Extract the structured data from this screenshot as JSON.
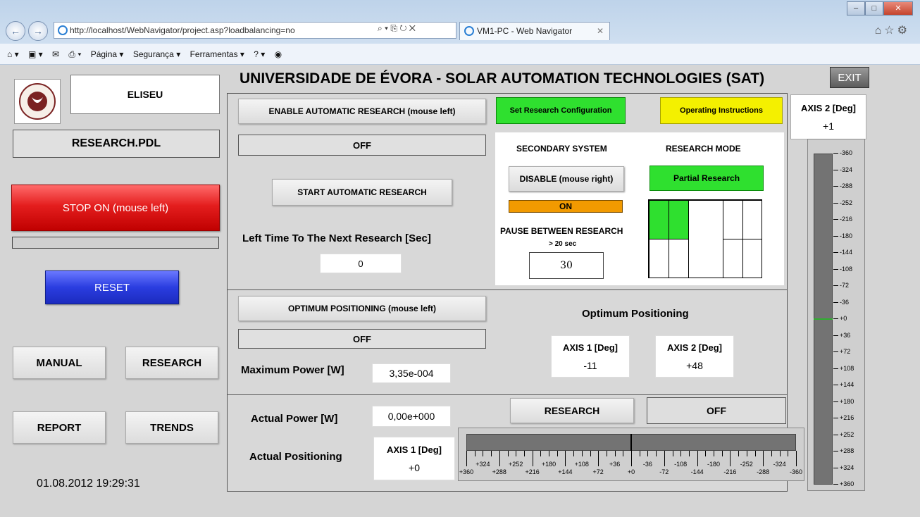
{
  "browser": {
    "url": "http://localhost/WebNavigator/project.asp?loadbalancing=no",
    "url_host": "localhost",
    "addr_tools": "⌕ ▾ ⎘ ↻ ✕",
    "tab_title": "VM1-PC - Web Navigator",
    "tab_close": "✕",
    "window_buttons": {
      "minimize": "–",
      "maximize": "□",
      "close": "✕"
    },
    "right_icons": "⌂☆⚙",
    "back": "←",
    "forward": "→",
    "menu": {
      "home": "⌂ ▾",
      "feeds": "▣ ▾",
      "mail": "✉",
      "print": "⎙ ▾",
      "pagina": "Página ▾",
      "seguranca": "Segurança ▾",
      "ferramentas": "Ferramentas ▾",
      "help": "? ▾",
      "extra": "◉"
    }
  },
  "app": {
    "title": "UNIVERSIDADE DE ÉVORA - SOLAR AUTOMATION TECHNOLOGIES (SAT)",
    "exit_label": "EXIT",
    "user": "ELISEU",
    "program": "RESEARCH.PDL",
    "logo_alt": "UNIVERSIDADE DE ÉVORA",
    "stop_label": "STOP ON (mouse left)",
    "reset_label": "RESET",
    "nav": {
      "manual": "MANUAL",
      "research": "RESEARCH",
      "report": "REPORT",
      "trends": "TRENDS"
    },
    "datetime": "01.08.2012 19:29:31"
  },
  "research": {
    "enable_auto_label": "ENABLE AUTOMATIC RESEARCH (mouse left)",
    "enable_auto_state": "OFF",
    "set_config_label": "Set Research Configuration",
    "operating_instructions_label": "Operating Instructions",
    "start_auto_label": "START AUTOMATIC RESEARCH",
    "left_time_label": "Left Time To The Next Research [Sec]",
    "left_time_value": "0",
    "secondary_system_label": "SECONDARY SYSTEM",
    "disable_label": "DISABLE (mouse right)",
    "secondary_state": "ON",
    "pause_label": "PAUSE BETWEEN RESEARCH",
    "pause_hint": "> 20 sec",
    "pause_value": "30",
    "research_mode_label": "RESEARCH MODE",
    "research_mode_value": "Partial Research"
  },
  "optimum": {
    "button_label": "OPTIMUM POSITIONING (mouse left)",
    "state": "OFF",
    "title": "Optimum Positioning",
    "axis1_label": "AXIS 1 [Deg]",
    "axis1_value": "-11",
    "axis2_label": "AXIS 2 [Deg]",
    "axis2_value": "+48",
    "max_power_label": "Maximum Power [W]",
    "max_power_value": "3,35e-004"
  },
  "actual": {
    "power_label": "Actual Power [W]",
    "power_value": "0,00e+000",
    "positioning_label": "Actual Positioning",
    "axis1_label": "AXIS 1 [Deg]",
    "axis1_value": "+0",
    "research_button": "RESEARCH",
    "research_state": "OFF"
  },
  "axis2": {
    "label": "AXIS 2 [Deg]",
    "value": "+1",
    "scale_labels": [
      "-360",
      "-324",
      "-288",
      "-252",
      "-216",
      "-180",
      "-144",
      "-108",
      "-72",
      "-36",
      "+0",
      "+36",
      "+72",
      "+108",
      "+144",
      "+180",
      "+216",
      "+252",
      "+288",
      "+324",
      "+360"
    ]
  },
  "axis1_scale": {
    "upper_labels": [
      "+324",
      "+252",
      "+180",
      "+108",
      "+36",
      "-36",
      "-108",
      "-180",
      "-252",
      "-324"
    ],
    "lower_labels": [
      "+360",
      "+288",
      "+216",
      "+144",
      "+72",
      "+0",
      "-72",
      "-144",
      "-216",
      "-288",
      "-360"
    ]
  },
  "colors": {
    "stop": "#e41e1e",
    "reset": "#2a3de0",
    "green": "#2fe02f",
    "yellow": "#f4f000",
    "orange": "#f29a00"
  }
}
